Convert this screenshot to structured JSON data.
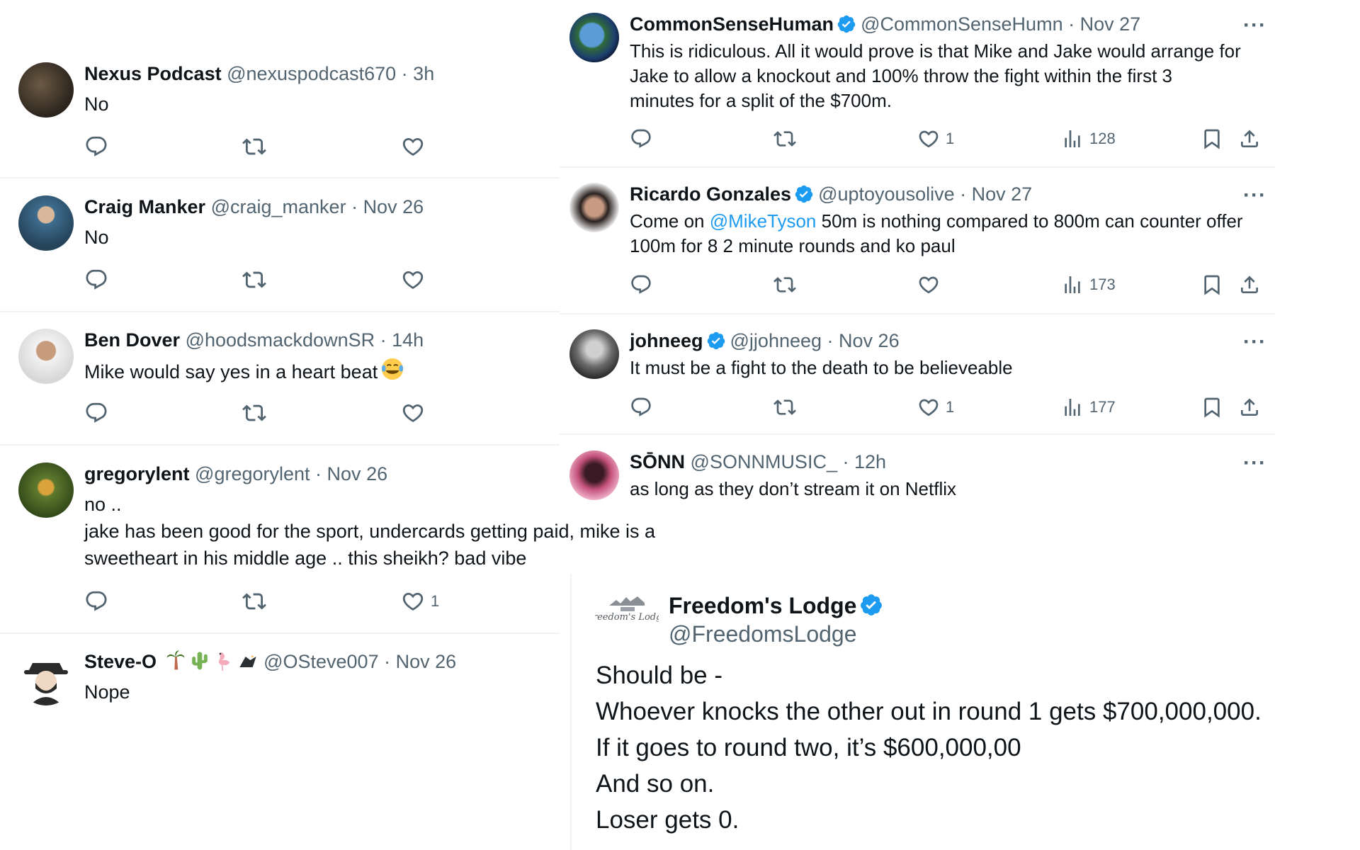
{
  "colors": {
    "text": "#0f1419",
    "muted": "#536471",
    "link": "#1d9bf0",
    "verified": "#1d9bf0",
    "divider": "#eff3f4"
  },
  "left_replies": [
    {
      "name": "Nexus Podcast",
      "handle": "@nexuspodcast670",
      "time": "3h",
      "lines": [
        "No"
      ],
      "likes": ""
    },
    {
      "name": "Craig Manker",
      "handle": "@craig_manker",
      "time": "Nov 26",
      "lines": [
        "No"
      ],
      "likes": ""
    },
    {
      "name": "Ben Dover",
      "handle": "@hoodsmackdownSR",
      "time": "14h",
      "lines": [
        "Mike would say yes in a heart beat"
      ],
      "emoji": "face-with-tears-of-joy",
      "likes": ""
    },
    {
      "name": "gregorylent",
      "handle": "@gregorylent",
      "time": "Nov 26",
      "lines": [
        "no ..",
        "jake has been good for the sport, undercards getting paid, mike is a",
        "sweetheart in his middle age .. this sheikh? bad vibe"
      ],
      "likes": "1"
    },
    {
      "name": "Steve-O",
      "name_emojis": [
        "palm-tree",
        "cactus",
        "flamingo",
        "eagle"
      ],
      "handle": "@OSteve007",
      "time": "Nov 26",
      "lines": [
        "Nope"
      ]
    }
  ],
  "right_replies": [
    {
      "name": "CommonSenseHuman",
      "verified": true,
      "handle": "@CommonSenseHumn",
      "time": "Nov 27",
      "lines": [
        "This is ridiculous.  All it would prove is that Mike and Jake would arrange for",
        "Jake to allow a knockout and 100% throw the fight within the first 3",
        "minutes for a split of the $700m."
      ],
      "likes": "1",
      "views": "128"
    },
    {
      "name": "Ricardo Gonzales",
      "verified": true,
      "handle": "@uptoyousolive",
      "time": "Nov 27",
      "line1_pre": "Come on ",
      "mention": "@MikeTyson",
      "line1_post": " 50m is nothing compared to 800m can counter offer",
      "line2": "100m for 8 2 minute rounds and ko paul",
      "likes": "",
      "views": "173"
    },
    {
      "name": "johneeg",
      "verified": true,
      "handle": "@jjohneeg",
      "time": "Nov 26",
      "lines": [
        "It must be a fight to the death to be believeable"
      ],
      "likes": "1",
      "views": "177"
    },
    {
      "name": "SŌNN",
      "handle": "@SONNMUSIC_",
      "time": "12h",
      "lines": [
        "as long as they don’t stream it on Netflix"
      ]
    }
  ],
  "main_post": {
    "name": "Freedom's Lodge",
    "verified": true,
    "handle": "@FreedomsLodge",
    "logo_text": "Freedom's Lodge",
    "lines": [
      "Should be -",
      "Whoever knocks the other out in round 1 gets $700,000,000.",
      "If it goes to round two, it’s $600,000,00",
      "And so on.",
      "Loser gets 0."
    ]
  },
  "icons": {
    "reply": "reply-icon",
    "repost": "repost-icon",
    "like": "heart-icon",
    "views": "views-icon",
    "bookmark": "bookmark-icon",
    "share": "share-icon",
    "more": "more-icon"
  },
  "more_label": "···",
  "separator": " · "
}
